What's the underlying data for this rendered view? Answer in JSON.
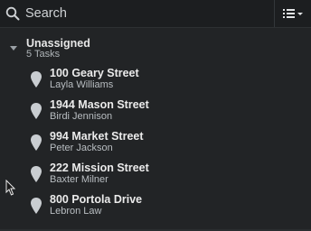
{
  "search": {
    "placeholder": "Search"
  },
  "group": {
    "title": "Unassigned",
    "count": "5 Tasks"
  },
  "tasks": [
    {
      "address": "100 Geary Street",
      "person": "Layla Williams"
    },
    {
      "address": "1944 Mason Street",
      "person": "Birdi Jennison"
    },
    {
      "address": "994 Market Street",
      "person": "Peter Jackson"
    },
    {
      "address": "222 Mission Street",
      "person": "Baxter Milner"
    },
    {
      "address": "800 Portola Drive",
      "person": "Lebron Law"
    }
  ],
  "icons": {
    "search": "search-icon",
    "menu": "list-menu-icon",
    "caret": "caret-down-icon",
    "pin": "map-pin-icon"
  },
  "colors": {
    "background": "#222426",
    "topbar": "#1c1e20",
    "pin": "#c9cdd1"
  }
}
